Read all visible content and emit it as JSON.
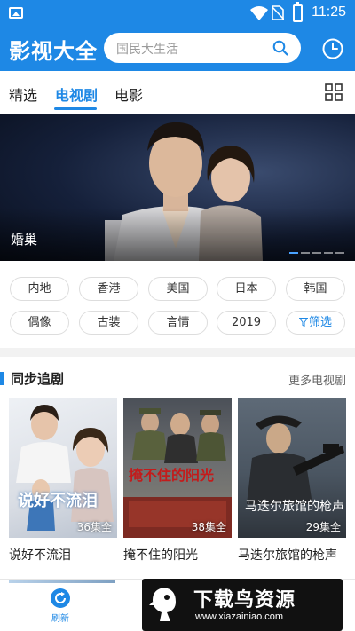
{
  "status_bar": {
    "time": "11:25"
  },
  "app_bar": {
    "title": "影视大全",
    "search_placeholder": "国民大生活"
  },
  "tabs": [
    {
      "label": "精选",
      "active": false
    },
    {
      "label": "电视剧",
      "active": true
    },
    {
      "label": "电影",
      "active": false
    }
  ],
  "banner": {
    "title": "婚巢",
    "dots": 5,
    "active_dot": 0
  },
  "filters": {
    "row1": [
      "内地",
      "香港",
      "美国",
      "日本",
      "韩国"
    ],
    "row2": [
      "偶像",
      "古装",
      "言情",
      "2019"
    ],
    "filter_label": "筛选"
  },
  "section": {
    "title": "同步追剧",
    "more": "更多电视剧",
    "cards": [
      {
        "title": "说好不流泪",
        "episodes": "36集全",
        "poster_text": "说好不流泪"
      },
      {
        "title": "掩不住的阳光",
        "episodes": "38集全",
        "poster_text": "掩不住的阳光"
      },
      {
        "title": "马迭尔旅馆的枪声",
        "episodes": "29集全",
        "poster_text": "马迭尔旅馆的枪声"
      }
    ]
  },
  "bottom_nav": {
    "refresh_label": "刷新"
  },
  "watermark": {
    "main": "下载鸟资源",
    "url": "www.xiazainiao.com"
  },
  "colors": {
    "primary": "#1e88e5",
    "background": "#f2f2f2"
  }
}
